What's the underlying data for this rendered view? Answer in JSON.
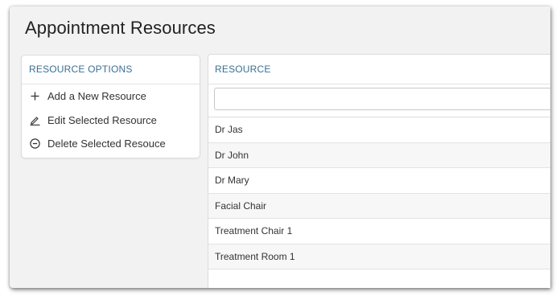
{
  "page": {
    "title": "Appointment Resources"
  },
  "options": {
    "header": "RESOURCE OPTIONS",
    "items": [
      {
        "label": "Add a New Resource",
        "icon": "plus-icon"
      },
      {
        "label": "Edit Selected Resource",
        "icon": "pencil-icon"
      },
      {
        "label": "Delete Selected Resouce",
        "icon": "minus-circle-icon"
      }
    ]
  },
  "resources": {
    "header": "RESOURCE",
    "filter": {
      "value": "",
      "placeholder": ""
    },
    "rows": [
      "Dr Jas",
      "Dr John",
      "Dr Mary",
      "Facial Chair",
      "Treatment Chair 1",
      "Treatment Room 1"
    ]
  },
  "colors": {
    "header_text": "#3a6f94",
    "window_bg": "#f2f2f2",
    "row_alt_bg": "#f7f7f7"
  }
}
